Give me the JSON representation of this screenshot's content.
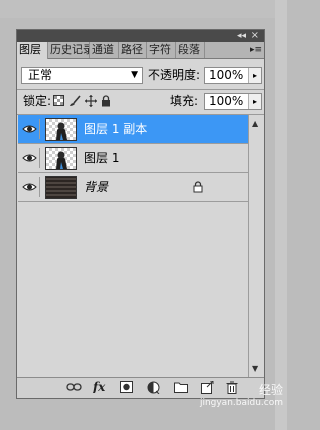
{
  "panel": {
    "tabs": [
      {
        "label": "图层",
        "active": true
      },
      {
        "label": "历史记录",
        "active": false
      },
      {
        "label": "通道",
        "active": false
      },
      {
        "label": "路径",
        "active": false
      },
      {
        "label": "字符",
        "active": false
      },
      {
        "label": "段落",
        "active": false
      }
    ],
    "menu_icon": "panel-menu-icon"
  },
  "controls": {
    "blend_mode": "正常",
    "opacity_label": "不透明度:",
    "opacity_value": "100%",
    "lock_label": "锁定:",
    "fill_label": "填充:",
    "fill_value": "100%"
  },
  "layers": [
    {
      "name": "图层 1 副本",
      "selected": true,
      "visible": true,
      "thumb": "checker-portrait"
    },
    {
      "name": "图层 1",
      "selected": false,
      "visible": true,
      "thumb": "checker-portrait"
    },
    {
      "name": "背景",
      "selected": false,
      "visible": true,
      "thumb": "dark-texture",
      "locked": true
    }
  ],
  "watermark": {
    "line1": "经验",
    "line2": "jingyan.baidu.com"
  },
  "colors": {
    "selected": "#3c97f5",
    "panel": "#d6d6d6",
    "titlebar": "#4a4a4a"
  }
}
